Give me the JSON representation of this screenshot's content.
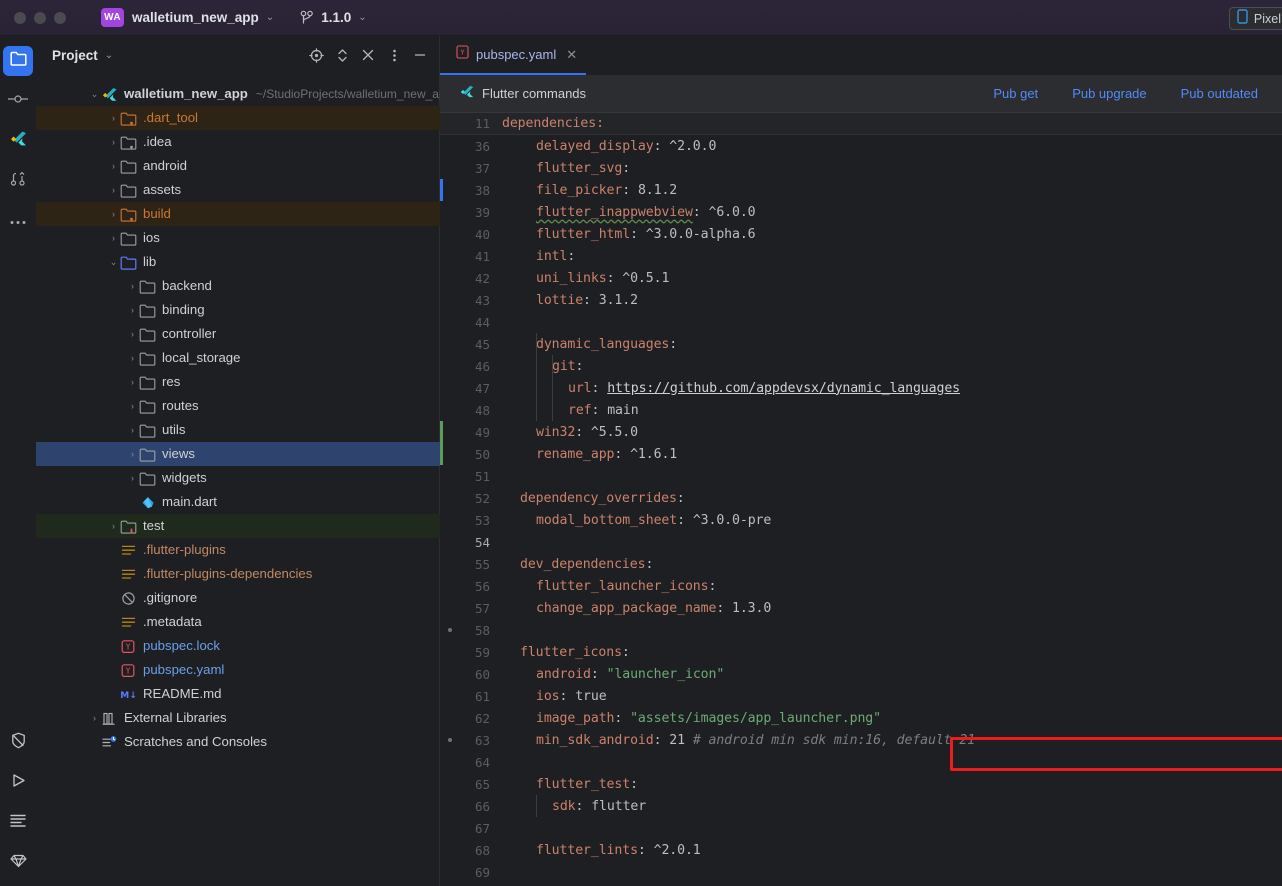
{
  "titlebar": {
    "project_badge": "WA",
    "project_name": "walletium_new_app",
    "branch": "1.1.0",
    "device": "Pixel",
    "chevron": "⌄"
  },
  "rail": {
    "items": [
      {
        "name": "project-folder-icon",
        "label": "Project"
      },
      {
        "name": "commit-icon",
        "label": "Commit"
      },
      {
        "name": "flutter-icon",
        "label": "Flutter"
      },
      {
        "name": "pull-requests-icon",
        "label": "Pull Requests"
      },
      {
        "name": "more-tool-windows-icon",
        "label": "More"
      }
    ],
    "bottom_items": [
      {
        "name": "no-entry-icon",
        "label": "Problems"
      },
      {
        "name": "run-icon",
        "label": "Run"
      },
      {
        "name": "terminal-lines-icon",
        "label": "Terminal"
      },
      {
        "name": "diamond-icon",
        "label": "Database"
      }
    ]
  },
  "panel": {
    "title": "Project",
    "actions": [
      {
        "name": "locate-target-icon",
        "label": "Select Opened File"
      },
      {
        "name": "expand-collapse-icon",
        "label": "Expand All"
      },
      {
        "name": "collapse-all-icon",
        "label": "Collapse All"
      },
      {
        "name": "more-options-icon",
        "label": "Options"
      },
      {
        "name": "minimize-icon",
        "label": "Hide"
      }
    ]
  },
  "tree": [
    {
      "label": "walletium_new_app",
      "sub": "~/StudioProjects/walletium_new_app",
      "indent": 0,
      "arrow": "open",
      "icon": "flutter",
      "color": "white",
      "bold": true
    },
    {
      "label": ".dart_tool",
      "indent": 1,
      "arrow": "closed",
      "icon": "folder-excluded",
      "color": "orange",
      "highlight": "orange"
    },
    {
      "label": ".idea",
      "indent": 1,
      "arrow": "closed",
      "icon": "folder-module",
      "color": "white"
    },
    {
      "label": "android",
      "indent": 1,
      "arrow": "closed",
      "icon": "folder",
      "color": "white"
    },
    {
      "label": "assets",
      "indent": 1,
      "arrow": "closed",
      "icon": "folder",
      "color": "white"
    },
    {
      "label": "build",
      "indent": 1,
      "arrow": "closed",
      "icon": "folder-excluded",
      "color": "orange",
      "highlight": "orange"
    },
    {
      "label": "ios",
      "indent": 1,
      "arrow": "closed",
      "icon": "folder",
      "color": "white"
    },
    {
      "label": "lib",
      "indent": 1,
      "arrow": "open",
      "icon": "folder-source",
      "color": "white"
    },
    {
      "label": "backend",
      "indent": 2,
      "arrow": "closed",
      "icon": "folder",
      "color": "white"
    },
    {
      "label": "binding",
      "indent": 2,
      "arrow": "closed",
      "icon": "folder",
      "color": "white"
    },
    {
      "label": "controller",
      "indent": 2,
      "arrow": "closed",
      "icon": "folder",
      "color": "white"
    },
    {
      "label": "local_storage",
      "indent": 2,
      "arrow": "closed",
      "icon": "folder",
      "color": "white"
    },
    {
      "label": "res",
      "indent": 2,
      "arrow": "closed",
      "icon": "folder",
      "color": "white"
    },
    {
      "label": "routes",
      "indent": 2,
      "arrow": "closed",
      "icon": "folder",
      "color": "white"
    },
    {
      "label": "utils",
      "indent": 2,
      "arrow": "closed",
      "icon": "folder",
      "color": "white"
    },
    {
      "label": "views",
      "indent": 2,
      "arrow": "closed",
      "icon": "folder",
      "color": "white",
      "selected": true
    },
    {
      "label": "widgets",
      "indent": 2,
      "arrow": "closed",
      "icon": "folder",
      "color": "white"
    },
    {
      "label": "main.dart",
      "indent": 2,
      "arrow": "none",
      "icon": "dart",
      "color": "white"
    },
    {
      "label": "test",
      "indent": 1,
      "arrow": "closed",
      "icon": "folder-test",
      "color": "white",
      "highlight": "green"
    },
    {
      "label": ".flutter-plugins",
      "indent": 1,
      "arrow": "none",
      "icon": "text-file",
      "color": "salmon"
    },
    {
      "label": ".flutter-plugins-dependencies",
      "indent": 1,
      "arrow": "none",
      "icon": "text-file",
      "color": "salmon"
    },
    {
      "label": ".gitignore",
      "indent": 1,
      "arrow": "none",
      "icon": "ignore-file",
      "color": "white"
    },
    {
      "label": ".metadata",
      "indent": 1,
      "arrow": "none",
      "icon": "text-file",
      "color": "white"
    },
    {
      "label": "pubspec.lock",
      "indent": 1,
      "arrow": "none",
      "icon": "yaml-file",
      "color": "blue"
    },
    {
      "label": "pubspec.yaml",
      "indent": 1,
      "arrow": "none",
      "icon": "yaml-file",
      "color": "blue"
    },
    {
      "label": "README.md",
      "indent": 1,
      "arrow": "none",
      "icon": "markdown-file",
      "color": "white"
    },
    {
      "label": "External Libraries",
      "indent": 0,
      "arrow": "closed",
      "icon": "library",
      "color": "white"
    },
    {
      "label": "Scratches and Consoles",
      "indent": 0,
      "arrow": "none",
      "icon": "scratches",
      "color": "white"
    }
  ],
  "editor": {
    "tab": {
      "label": "pubspec.yaml",
      "close": "✕"
    },
    "flutter_commands": {
      "label": "Flutter commands",
      "links": [
        "Pub get",
        "Pub upgrade",
        "Pub outdated"
      ]
    },
    "sticky_header": {
      "number": "11",
      "text": "dependencies:"
    },
    "lines": [
      {
        "n": "36",
        "indent": 1,
        "parts": [
          {
            "t": "delayed_display",
            "c": "k"
          },
          {
            "t": ": ",
            "c": "p"
          },
          {
            "t": "^2.0.0",
            "c": "n"
          }
        ]
      },
      {
        "n": "37",
        "indent": 1,
        "parts": [
          {
            "t": "flutter_svg",
            "c": "k"
          },
          {
            "t": ":",
            "c": "p"
          }
        ]
      },
      {
        "n": "38",
        "indent": 1,
        "marker": "blue",
        "parts": [
          {
            "t": "file_picker",
            "c": "k"
          },
          {
            "t": ": ",
            "c": "p"
          },
          {
            "t": "8.1.2",
            "c": "n"
          }
        ]
      },
      {
        "n": "39",
        "indent": 1,
        "parts": [
          {
            "t": "flutter_inappwebview",
            "c": "k squig"
          },
          {
            "t": ": ",
            "c": "p"
          },
          {
            "t": "^6.0.0",
            "c": "n"
          }
        ]
      },
      {
        "n": "40",
        "indent": 1,
        "parts": [
          {
            "t": "flutter_html",
            "c": "k"
          },
          {
            "t": ": ",
            "c": "p"
          },
          {
            "t": "^3.0.0-alpha.6",
            "c": "n"
          }
        ]
      },
      {
        "n": "41",
        "indent": 1,
        "parts": [
          {
            "t": "intl",
            "c": "k"
          },
          {
            "t": ":",
            "c": "p"
          }
        ]
      },
      {
        "n": "42",
        "indent": 1,
        "parts": [
          {
            "t": "uni_links",
            "c": "k"
          },
          {
            "t": ": ",
            "c": "p"
          },
          {
            "t": "^0.5.1",
            "c": "n"
          }
        ]
      },
      {
        "n": "43",
        "indent": 1,
        "parts": [
          {
            "t": "lottie",
            "c": "k"
          },
          {
            "t": ": ",
            "c": "p"
          },
          {
            "t": "3.1.2",
            "c": "n"
          }
        ]
      },
      {
        "n": "44",
        "indent": 0,
        "parts": []
      },
      {
        "n": "45",
        "indent": 1,
        "parts": [
          {
            "t": "dynamic_languages",
            "c": "k"
          },
          {
            "t": ":",
            "c": "p"
          }
        ]
      },
      {
        "n": "46",
        "indent": 2,
        "parts": [
          {
            "t": "git",
            "c": "k"
          },
          {
            "t": ":",
            "c": "p"
          }
        ]
      },
      {
        "n": "47",
        "indent": 3,
        "parts": [
          {
            "t": "url",
            "c": "k"
          },
          {
            "t": ": ",
            "c": "p"
          },
          {
            "t": "https://github.com/appdevsx/dynamic_languages",
            "c": "url"
          }
        ]
      },
      {
        "n": "48",
        "indent": 3,
        "parts": [
          {
            "t": "ref",
            "c": "k"
          },
          {
            "t": ": ",
            "c": "p"
          },
          {
            "t": "main",
            "c": "n"
          }
        ]
      },
      {
        "n": "49",
        "indent": 1,
        "marker": "green",
        "parts": [
          {
            "t": "win32",
            "c": "k"
          },
          {
            "t": ": ",
            "c": "p"
          },
          {
            "t": "^5.5.0",
            "c": "n"
          }
        ]
      },
      {
        "n": "50",
        "indent": 1,
        "marker": "green",
        "parts": [
          {
            "t": "rename_app",
            "c": "k"
          },
          {
            "t": ": ",
            "c": "p"
          },
          {
            "t": "^1.6.1",
            "c": "n"
          }
        ]
      },
      {
        "n": "51",
        "indent": 0,
        "parts": []
      },
      {
        "n": "52",
        "indent": 0,
        "parts": [
          {
            "t": "dependency_overrides",
            "c": "k"
          },
          {
            "t": ":",
            "c": "p"
          }
        ]
      },
      {
        "n": "53",
        "indent": 1,
        "parts": [
          {
            "t": "modal_bottom_sheet",
            "c": "k"
          },
          {
            "t": ": ",
            "c": "p"
          },
          {
            "t": "^3.0.0-pre",
            "c": "n"
          }
        ]
      },
      {
        "n": "54",
        "indent": 0,
        "current": true,
        "parts": []
      },
      {
        "n": "55",
        "indent": 0,
        "parts": [
          {
            "t": "dev_dependencies",
            "c": "k"
          },
          {
            "t": ":",
            "c": "p"
          }
        ]
      },
      {
        "n": "56",
        "indent": 1,
        "parts": [
          {
            "t": "flutter_launcher_icons",
            "c": "k"
          },
          {
            "t": ":",
            "c": "p"
          }
        ]
      },
      {
        "n": "57",
        "indent": 1,
        "parts": [
          {
            "t": "change_app_package_name",
            "c": "k"
          },
          {
            "t": ": ",
            "c": "p"
          },
          {
            "t": "1.3.0",
            "c": "n"
          }
        ]
      },
      {
        "n": "58",
        "indent": 0,
        "folddot": true,
        "parts": []
      },
      {
        "n": "59",
        "indent": 0,
        "parts": [
          {
            "t": "flutter_icons",
            "c": "k"
          },
          {
            "t": ":",
            "c": "p"
          }
        ]
      },
      {
        "n": "60",
        "indent": 1,
        "parts": [
          {
            "t": "android",
            "c": "k"
          },
          {
            "t": ": ",
            "c": "p"
          },
          {
            "t": "\"launcher_icon\"",
            "c": "str"
          }
        ]
      },
      {
        "n": "61",
        "indent": 1,
        "parts": [
          {
            "t": "ios",
            "c": "k"
          },
          {
            "t": ": ",
            "c": "p"
          },
          {
            "t": "true",
            "c": "n"
          }
        ]
      },
      {
        "n": "62",
        "indent": 1,
        "parts": [
          {
            "t": "image_path",
            "c": "k"
          },
          {
            "t": ": ",
            "c": "p"
          },
          {
            "t": "\"assets/images/app_launcher.png\"",
            "c": "str"
          }
        ]
      },
      {
        "n": "63",
        "indent": 1,
        "folddot": true,
        "parts": [
          {
            "t": "min_sdk_android",
            "c": "k"
          },
          {
            "t": ": ",
            "c": "p"
          },
          {
            "t": "21 ",
            "c": "n"
          },
          {
            "t": "# android min sdk min:16, default 21",
            "c": "cmt"
          }
        ]
      },
      {
        "n": "64",
        "indent": 0,
        "parts": []
      },
      {
        "n": "65",
        "indent": 1,
        "parts": [
          {
            "t": "flutter_test",
            "c": "k"
          },
          {
            "t": ":",
            "c": "p"
          }
        ]
      },
      {
        "n": "66",
        "indent": 2,
        "parts": [
          {
            "t": "sdk",
            "c": "k"
          },
          {
            "t": ": ",
            "c": "p"
          },
          {
            "t": "flutter",
            "c": "n"
          }
        ]
      },
      {
        "n": "67",
        "indent": 0,
        "parts": []
      },
      {
        "n": "68",
        "indent": 1,
        "parts": [
          {
            "t": "flutter_lints",
            "c": "k"
          },
          {
            "t": ": ",
            "c": "p"
          },
          {
            "t": "^2.0.1",
            "c": "n"
          }
        ]
      },
      {
        "n": "69",
        "indent": 0,
        "parts": []
      }
    ],
    "annotation": {
      "name": "red-highlight-box",
      "color": "#f01b1b"
    }
  }
}
